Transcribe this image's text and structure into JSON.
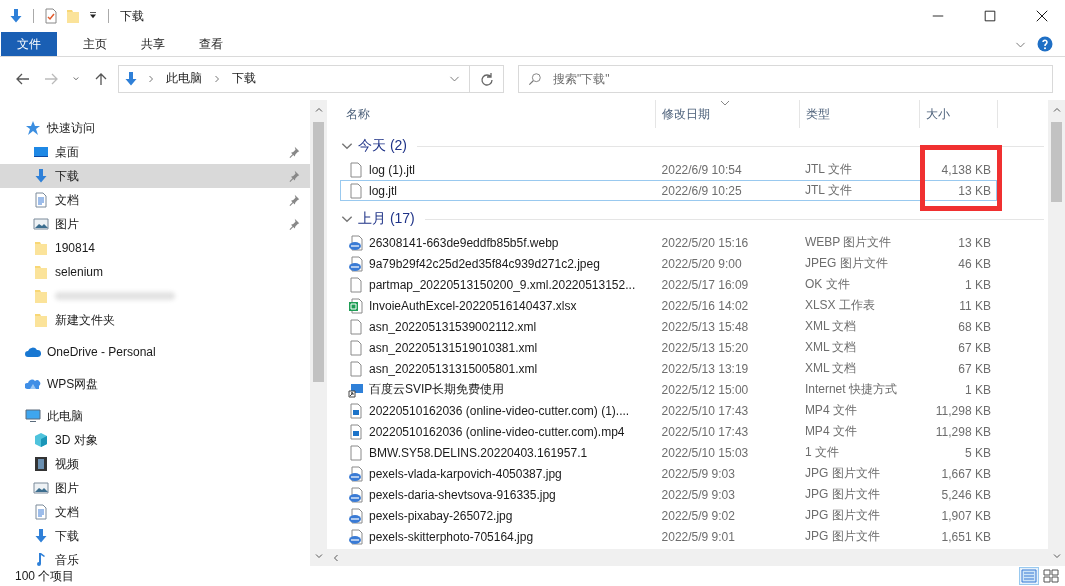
{
  "window": {
    "title": "下载"
  },
  "ribbon": {
    "tabs": [
      {
        "label": "文件",
        "selected": true
      },
      {
        "label": "主页",
        "selected": false
      },
      {
        "label": "共享",
        "selected": false
      },
      {
        "label": "查看",
        "selected": false
      }
    ]
  },
  "nav_buttons": [
    {
      "kind": "back",
      "disabled": false
    },
    {
      "kind": "forward",
      "disabled": true
    },
    {
      "kind": "recent",
      "disabled": false
    },
    {
      "kind": "up",
      "disabled": false
    }
  ],
  "address": {
    "path": [
      "此电脑",
      "下载"
    ]
  },
  "search": {
    "placeholder": "搜索\"下载\""
  },
  "sidebar": {
    "items": [
      {
        "label": "快速访问",
        "kind": "star",
        "selected": false,
        "children": [
          {
            "label": "桌面",
            "kind": "desktop",
            "selected": false,
            "pinned": true
          },
          {
            "label": "下载",
            "kind": "download",
            "selected": true,
            "pinned": true
          },
          {
            "label": "文档",
            "kind": "document",
            "selected": false,
            "pinned": true
          },
          {
            "label": "图片",
            "kind": "pictures",
            "selected": false,
            "pinned": true
          },
          {
            "label": "190814",
            "kind": "folder",
            "selected": false,
            "pinned": false
          },
          {
            "label": "selenium",
            "kind": "folder",
            "selected": false,
            "pinned": false
          },
          {
            "kind": "redacted",
            "selected": false,
            "pinned": false
          },
          {
            "label": "新建文件夹",
            "kind": "folder",
            "selected": false,
            "pinned": false
          }
        ]
      },
      {
        "label": "OneDrive - Personal",
        "kind": "cloud",
        "selected": false
      },
      {
        "label": "WPS网盘",
        "kind": "wps",
        "selected": false
      },
      {
        "label": "此电脑",
        "kind": "pc",
        "selected": false,
        "children": [
          {
            "label": "3D 对象",
            "kind": "cube",
            "selected": false,
            "pinned": false
          },
          {
            "label": "视频",
            "kind": "video",
            "selected": false,
            "pinned": false
          },
          {
            "label": "图片",
            "kind": "pictures",
            "selected": false,
            "pinned": false
          },
          {
            "label": "文档",
            "kind": "document",
            "selected": false,
            "pinned": false
          },
          {
            "label": "下载",
            "kind": "download",
            "selected": false,
            "pinned": false
          },
          {
            "label": "音乐",
            "kind": "music",
            "selected": false,
            "pinned": false
          }
        ]
      }
    ]
  },
  "columns": [
    {
      "label": "名称",
      "sorted": false
    },
    {
      "label": "修改日期",
      "sorted": true
    },
    {
      "label": "类型",
      "sorted": false
    },
    {
      "label": "大小",
      "sorted": false
    }
  ],
  "groups": [
    {
      "label": "今天 (2)",
      "expanded": true,
      "highlight_sizes": true,
      "files": [
        {
          "name": "log (1).jtl",
          "date": "2022/6/9 10:54",
          "type": "JTL 文件",
          "size": "4,138 KB",
          "kind": "blank",
          "focused": false
        },
        {
          "name": "log.jtl",
          "date": "2022/6/9 10:25",
          "type": "JTL 文件",
          "size": "13 KB",
          "kind": "blank",
          "focused": true
        }
      ]
    },
    {
      "label": "上月 (17)",
      "expanded": true,
      "highlight_sizes": false,
      "files": [
        {
          "name": "26308141-663de9eddfb85b5f.webp",
          "date": "2022/5/20 15:16",
          "type": "WEBP 图片文件",
          "size": "13 KB",
          "kind": "image",
          "focused": false
        },
        {
          "name": "9a79b29f42c25d2ed35f84c939d271c2.jpeg",
          "date": "2022/5/20 9:00",
          "type": "JPEG 图片文件",
          "size": "46 KB",
          "kind": "image",
          "focused": false
        },
        {
          "name": "partmap_20220513150200_9.xml.20220513152...",
          "date": "2022/5/17 16:09",
          "type": "OK 文件",
          "size": "1 KB",
          "kind": "blank",
          "focused": false
        },
        {
          "name": "InvoieAuthExcel-20220516140437.xlsx",
          "date": "2022/5/16 14:02",
          "type": "XLSX 工作表",
          "size": "11 KB",
          "kind": "sheet",
          "focused": false
        },
        {
          "name": "asn_202205131539002112.xml",
          "date": "2022/5/13 15:48",
          "type": "XML 文档",
          "size": "68 KB",
          "kind": "blank",
          "focused": false
        },
        {
          "name": "asn_202205131519010381.xml",
          "date": "2022/5/13 15:20",
          "type": "XML 文档",
          "size": "67 KB",
          "kind": "blank",
          "focused": false
        },
        {
          "name": "asn_202205131315005801.xml",
          "date": "2022/5/13 13:19",
          "type": "XML 文档",
          "size": "67 KB",
          "kind": "blank",
          "focused": false
        },
        {
          "name": "百度云SVIP长期免费使用",
          "date": "2022/5/12 15:00",
          "type": "Internet 快捷方式",
          "size": "1 KB",
          "kind": "shortcut",
          "focused": false
        },
        {
          "name": "20220510162036 (online-video-cutter.com) (1)....",
          "date": "2022/5/10 17:43",
          "type": "MP4 文件",
          "size": "11,298 KB",
          "kind": "movie",
          "focused": false
        },
        {
          "name": "20220510162036 (online-video-cutter.com).mp4",
          "date": "2022/5/10 17:43",
          "type": "MP4 文件",
          "size": "11,298 KB",
          "kind": "movie",
          "focused": false
        },
        {
          "name": "BMW.SY58.DELINS.20220403.161957.1",
          "date": "2022/5/10 15:03",
          "type": "1 文件",
          "size": "5 KB",
          "kind": "blank",
          "focused": false
        },
        {
          "name": "pexels-vlada-karpovich-4050387.jpg",
          "date": "2022/5/9 9:03",
          "type": "JPG 图片文件",
          "size": "1,667 KB",
          "kind": "image",
          "focused": false
        },
        {
          "name": "pexels-daria-shevtsova-916335.jpg",
          "date": "2022/5/9 9:03",
          "type": "JPG 图片文件",
          "size": "5,246 KB",
          "kind": "image",
          "focused": false
        },
        {
          "name": "pexels-pixabay-265072.jpg",
          "date": "2022/5/9 9:02",
          "type": "JPG 图片文件",
          "size": "1,907 KB",
          "kind": "image",
          "focused": false
        },
        {
          "name": "pexels-skitterphoto-705164.jpg",
          "date": "2022/5/9 9:01",
          "type": "JPG 图片文件",
          "size": "1,651 KB",
          "kind": "image",
          "focused": false
        }
      ]
    }
  ],
  "status_bar": {
    "count": "100 个项目",
    "views": [
      {
        "kind": "details",
        "selected": true
      },
      {
        "kind": "tiles",
        "selected": false
      }
    ]
  }
}
